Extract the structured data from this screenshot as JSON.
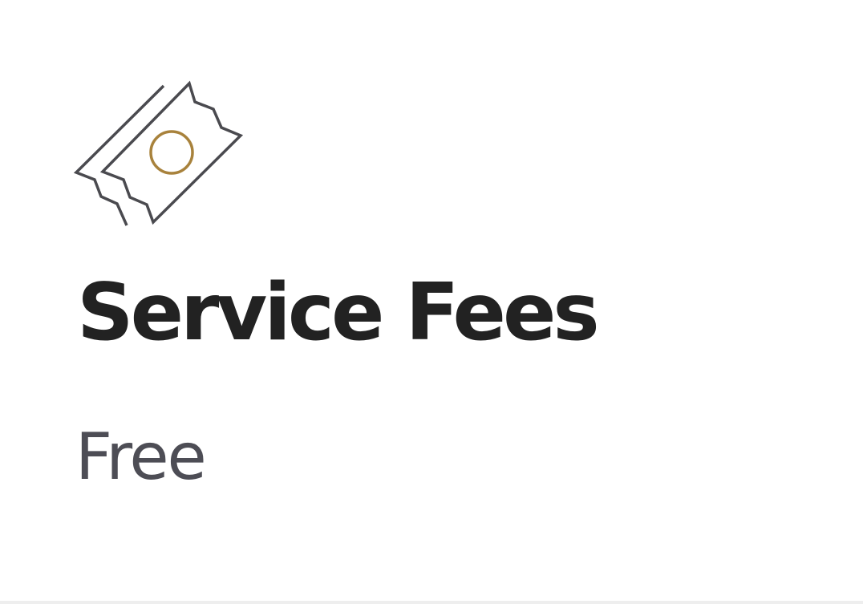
{
  "card": {
    "icon": "ticket-icon",
    "title": "Service Fees",
    "value": "Free"
  },
  "colors": {
    "icon_stroke": "#4a4a4f",
    "icon_accent": "#a8823c",
    "title": "#222222",
    "value": "#4d4d55"
  }
}
